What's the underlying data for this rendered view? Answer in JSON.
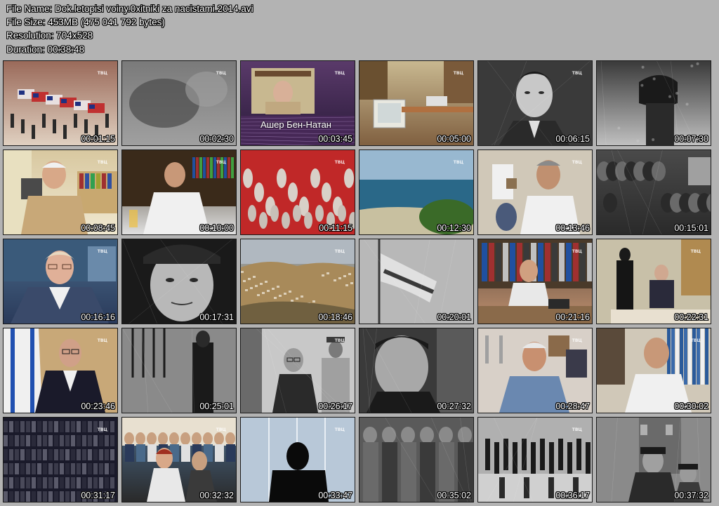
{
  "file_info": {
    "name": "File Name: Dok.letopisi voiny.0xitniki za nacistami.2014.avi",
    "size": "File Size: 453MB (475 041 792 bytes)",
    "resolution": "Resolution: 704x528",
    "duration": "Duration: 00:38:48"
  },
  "channel_logo": "ТВЦ",
  "caption_text": "Ашер Бен-Натан",
  "thumbnails": [
    {
      "time": "00:01:15",
      "scene": "parade-flags",
      "palette": [
        "#9a6a5a",
        "#c04030",
        "#e0d0c0"
      ]
    },
    {
      "time": "00:02:30",
      "scene": "blurry-gray",
      "palette": [
        "#7a7a7a",
        "#4a4a4a",
        "#a0a0a0"
      ]
    },
    {
      "time": "00:03:45",
      "scene": "interview-title",
      "palette": [
        "#5a3a6a",
        "#b8a890",
        "#2a1a3a"
      ]
    },
    {
      "time": "00:05:00",
      "scene": "office-computer",
      "palette": [
        "#c8b890",
        "#e8e0d0",
        "#806040"
      ]
    },
    {
      "time": "00:06:15",
      "scene": "bw-portrait",
      "palette": [
        "#2a2a2a",
        "#d0d0d0",
        "#606060"
      ]
    },
    {
      "time": "00:07:30",
      "scene": "bw-soldier",
      "palette": [
        "#3a3a3a",
        "#909090",
        "#c0c0c0"
      ]
    },
    {
      "time": "00:08:45",
      "scene": "old-man-shelves",
      "palette": [
        "#d8c8a0",
        "#c09070",
        "#f0e8d0"
      ]
    },
    {
      "time": "00:10:00",
      "scene": "man-bookshelf",
      "palette": [
        "#3a3020",
        "#d0b090",
        "#e0e0e0"
      ]
    },
    {
      "time": "00:11:15",
      "scene": "red-relief",
      "palette": [
        "#c02020",
        "#d0c0b0",
        "#803030"
      ]
    },
    {
      "time": "00:12:30",
      "scene": "coast",
      "palette": [
        "#80a8c8",
        "#2a6a8a",
        "#4a7a30"
      ]
    },
    {
      "time": "00:13:46",
      "scene": "office-man",
      "palette": [
        "#d0c8b8",
        "#c8a080",
        "#f0f0f0"
      ]
    },
    {
      "time": "00:15:01",
      "scene": "bw-crowd",
      "palette": [
        "#4a4a4a",
        "#8a8a8a",
        "#2a2a2a"
      ]
    },
    {
      "time": "00:16:16",
      "scene": "woman-glasses",
      "palette": [
        "#4a6a8a",
        "#e0b8a0",
        "#2a3a5a"
      ]
    },
    {
      "time": "00:17:31",
      "scene": "bw-face",
      "palette": [
        "#1a1a1a",
        "#c0c0c0",
        "#707070"
      ]
    },
    {
      "time": "00:18:46",
      "scene": "hills-city",
      "palette": [
        "#a8b0b8",
        "#a08050",
        "#706040"
      ]
    },
    {
      "time": "00:20:01",
      "scene": "bw-flag",
      "palette": [
        "#b0b0b0",
        "#3a3a3a",
        "#d8d8d8"
      ]
    },
    {
      "time": "00:21:16",
      "scene": "man-desk",
      "palette": [
        "#5a4a3a",
        "#e0d8c8",
        "#c09070"
      ]
    },
    {
      "time": "00:22:31",
      "scene": "woman-man-office",
      "palette": [
        "#c8c0a8",
        "#202020",
        "#e8e0d0"
      ]
    },
    {
      "time": "00:23:46",
      "scene": "man-israeli-flag",
      "palette": [
        "#c8a878",
        "#2a2a3a",
        "#f0f0f0"
      ]
    },
    {
      "time": "00:25:01",
      "scene": "bw-hanging",
      "palette": [
        "#5a5a5a",
        "#202020",
        "#a0a0a0"
      ]
    },
    {
      "time": "00:26:17",
      "scene": "bw-trial",
      "palette": [
        "#8a8a8a",
        "#2a2a2a",
        "#c8c8c8"
      ]
    },
    {
      "time": "00:27:32",
      "scene": "bw-closeup",
      "palette": [
        "#2a2a2a",
        "#b0b0b0",
        "#505050"
      ]
    },
    {
      "time": "00:28:47",
      "scene": "man-candlesticks",
      "palette": [
        "#d0c8c0",
        "#c09080",
        "#6080a0"
      ]
    },
    {
      "time": "00:30:02",
      "scene": "man-binders",
      "palette": [
        "#d8d0c0",
        "#c0a080",
        "#4a6a8a"
      ]
    },
    {
      "time": "00:31:17",
      "scene": "bookshelves-dark",
      "palette": [
        "#1a1a2a",
        "#6a6a7a",
        "#3a3a4a"
      ]
    },
    {
      "time": "00:32:32",
      "scene": "audience",
      "palette": [
        "#4a6a8a",
        "#d0b090",
        "#2a2a2a"
      ]
    },
    {
      "time": "00:33:47",
      "scene": "silhouette-window",
      "palette": [
        "#a0b0c8",
        "#101010",
        "#d0d8e8"
      ]
    },
    {
      "time": "00:35:02",
      "scene": "bw-soldiers",
      "palette": [
        "#4a4a4a",
        "#8a8a8a",
        "#c0c0c0"
      ]
    },
    {
      "time": "00:36:17",
      "scene": "bw-march",
      "palette": [
        "#9a9a9a",
        "#2a2a2a",
        "#d0d0d0"
      ]
    },
    {
      "time": "00:37:32",
      "scene": "bw-officers",
      "palette": [
        "#7a7a7a",
        "#2a2a2a",
        "#b0b0b0"
      ]
    }
  ]
}
